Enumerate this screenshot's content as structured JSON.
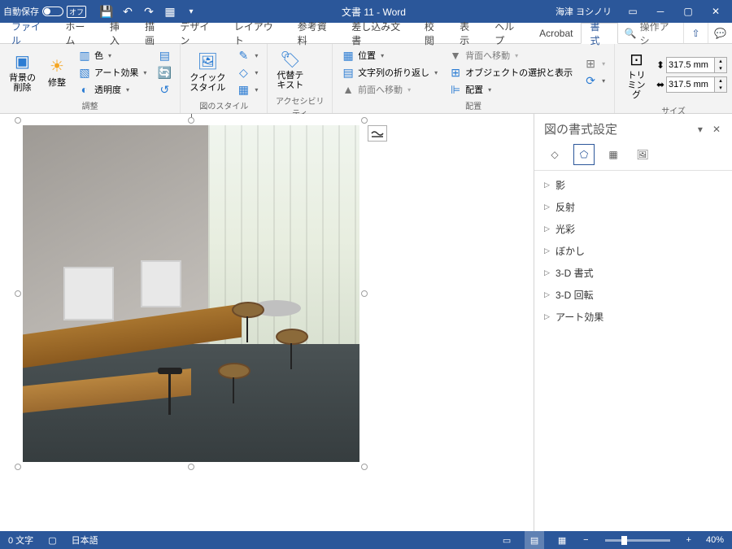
{
  "titlebar": {
    "autosave_label": "自動保存",
    "autosave_state": "オフ",
    "doc_title": "文書 11  -  Word",
    "user_name": "海津 ヨシノリ"
  },
  "tabs": {
    "file": "ファイル",
    "home": "ホーム",
    "insert": "挿入",
    "draw": "描画",
    "design": "デザイン",
    "layout": "レイアウト",
    "references": "参考資料",
    "mailings": "差し込み文書",
    "review": "校閲",
    "view": "表示",
    "help": "ヘルプ",
    "acrobat": "Acrobat",
    "format": "書式",
    "tell_placeholder": "操作アシ"
  },
  "ribbon": {
    "adjust": {
      "remove_bg": "背景の\n削除",
      "corrections": "修整",
      "color": "色",
      "artistic": "アート効果",
      "transparency": "透明度",
      "group_name": "調整"
    },
    "styles": {
      "quick": "クイック\nスタイル",
      "group_name": "図のスタイル"
    },
    "accessibility": {
      "alt_text": "代替テ\nキスト",
      "group_name": "アクセシビリティ"
    },
    "arrange": {
      "position": "位置",
      "wrap": "文字列の折り返し",
      "bring_fwd": "前面へ移動",
      "send_back": "背面へ移動",
      "selection_pane": "オブジェクトの選択と表示",
      "align": "配置",
      "group_name": "配置"
    },
    "size": {
      "crop": "トリミング",
      "height_label": "高さ",
      "height": "317.5 mm",
      "width_label": "幅",
      "width": "317.5 mm",
      "group_name": "サイズ"
    }
  },
  "pane": {
    "title": "図の書式設定",
    "items": {
      "shadow": "影",
      "reflection": "反射",
      "glow": "光彩",
      "soft_edges": "ぼかし",
      "format_3d": "3-D 書式",
      "rotation_3d": "3-D 回転",
      "artistic": "アート効果"
    }
  },
  "status": {
    "word_count": "0 文字",
    "language": "日本語",
    "zoom": "40%"
  }
}
